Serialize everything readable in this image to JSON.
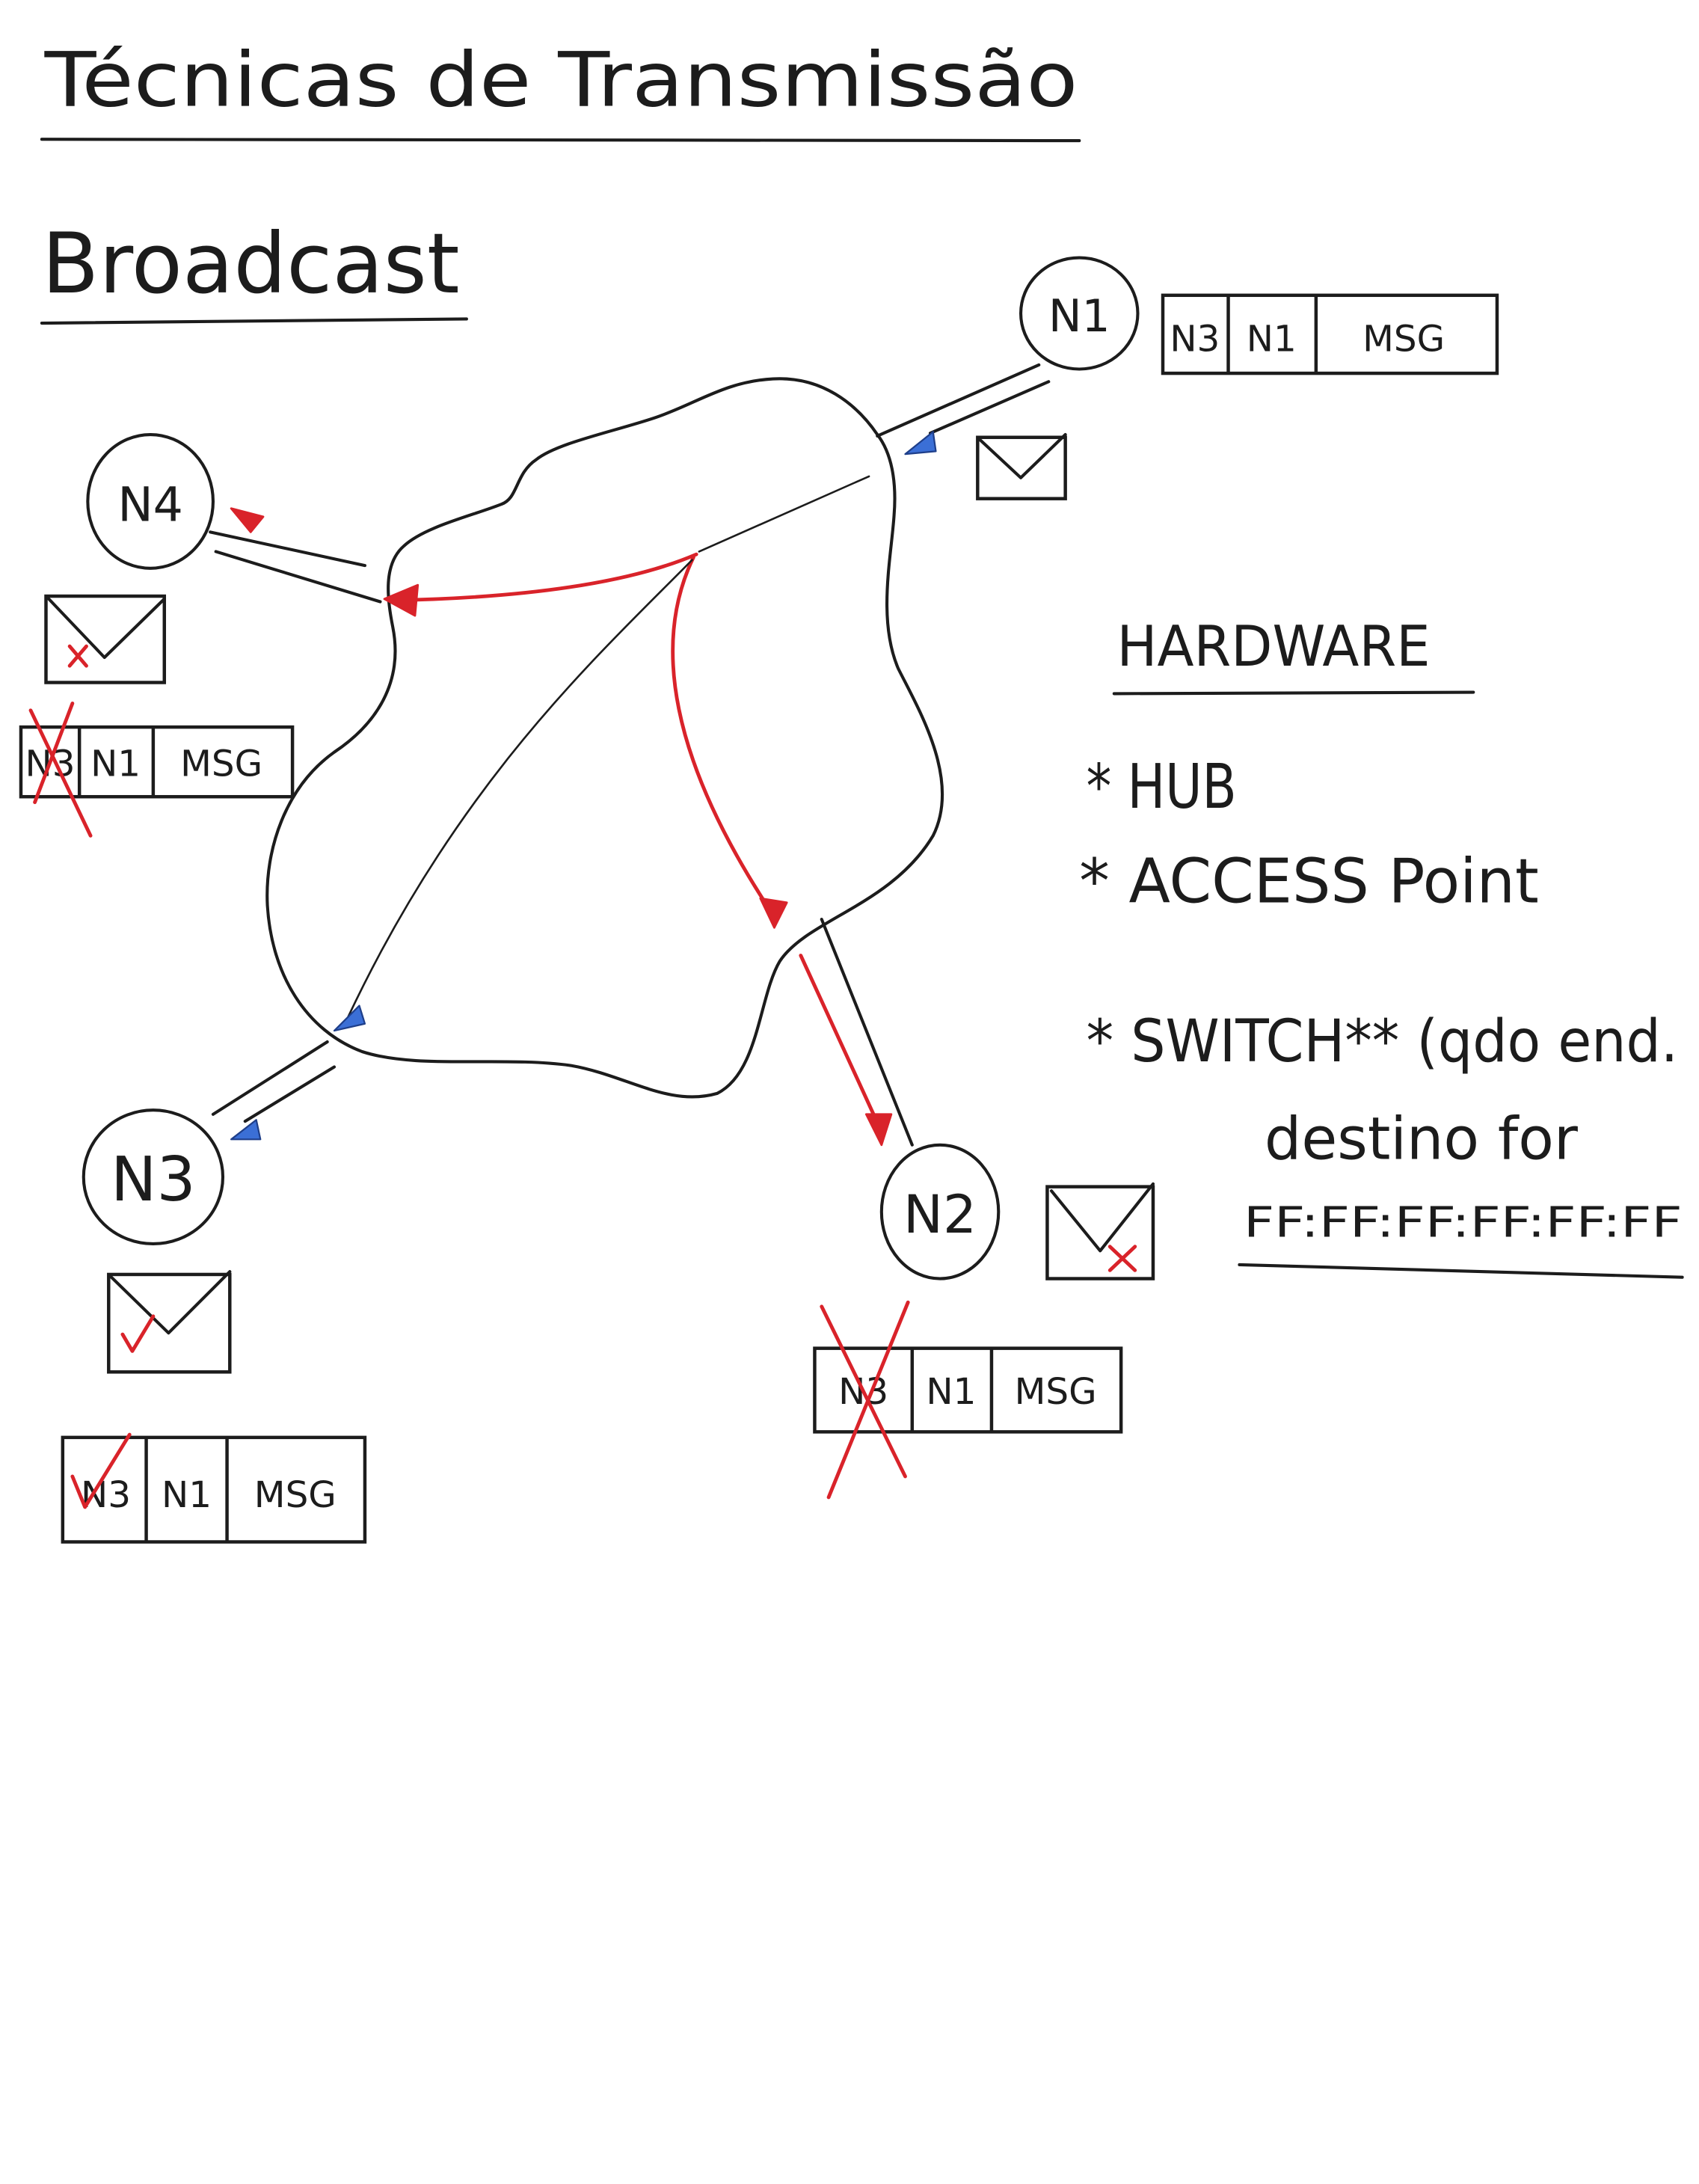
{
  "title": "Técnicas de Transmissão",
  "subtitle": "Broadcast",
  "colors": {
    "ink": "#1c1c1c",
    "red": "#d9232a",
    "blue": "#3b6fd6",
    "paper": "#ffffff"
  },
  "nodes": {
    "n1": "N1",
    "n2": "N2",
    "n3": "N3",
    "n4": "N4"
  },
  "frames": {
    "n1": {
      "dest": "N3",
      "src": "N1",
      "payload": "MSG",
      "mark": "none"
    },
    "n2": {
      "dest": "N3",
      "src": "N1",
      "payload": "MSG",
      "mark": "x-mark"
    },
    "n3": {
      "dest": "N3",
      "src": "N1",
      "payload": "MSG",
      "mark": "check-mark"
    },
    "n4": {
      "dest": "N3",
      "src": "N1",
      "payload": "MSG",
      "mark": "x-mark"
    }
  },
  "envelopes": {
    "n1": "envelope-icon",
    "n2": "envelope-x-icon",
    "n3": "envelope-check-icon",
    "n4": "envelope-x-icon"
  },
  "hardware": {
    "heading": "HARDWARE",
    "hub": "* HUB",
    "access_point": "* ACCESS Point",
    "switch_line1": "* SWITCH** (qdo end.",
    "switch_line2": "destino for",
    "switch_line3": "FF:FF:FF:FF:FF:FF"
  }
}
